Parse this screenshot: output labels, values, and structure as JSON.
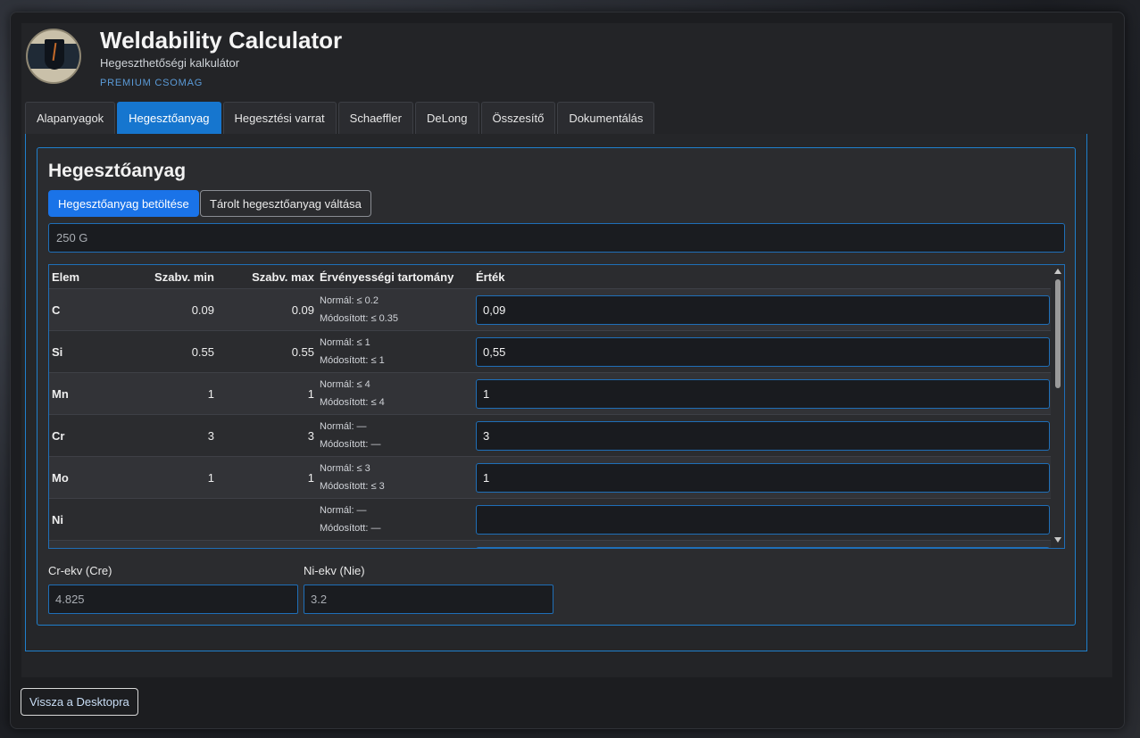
{
  "app": {
    "title": "Weldability Calculator",
    "subtitle": "Hegeszthetőségi kalkulátor",
    "badge": "PREMIUM CSOMAG"
  },
  "tabs": [
    {
      "label": "Alapanyagok",
      "active": false
    },
    {
      "label": "Hegesztőanyag",
      "active": true
    },
    {
      "label": "Hegesztési varrat",
      "active": false
    },
    {
      "label": "Schaeffler",
      "active": false
    },
    {
      "label": "DeLong",
      "active": false
    },
    {
      "label": "Összesítő",
      "active": false
    },
    {
      "label": "Dokumentálás",
      "active": false
    }
  ],
  "panel": {
    "heading": "Hegesztőanyag",
    "load_button": "Hegesztőanyag betöltése",
    "switch_button": "Tárolt hegesztőanyag váltása",
    "material_name": "250 G"
  },
  "table": {
    "headers": {
      "elem": "Elem",
      "min": "Szabv. min",
      "max": "Szabv. max",
      "range": "Érvényességi tartomány",
      "value": "Érték"
    },
    "rows": [
      {
        "elem": "C",
        "min": "0.09",
        "max": "0.09",
        "normal": "Normál: ≤ 0.2",
        "modified": "Módosított: ≤ 0.35",
        "value": "0,09"
      },
      {
        "elem": "Si",
        "min": "0.55",
        "max": "0.55",
        "normal": "Normál: ≤ 1",
        "modified": "Módosított: ≤ 1",
        "value": "0,55"
      },
      {
        "elem": "Mn",
        "min": "1",
        "max": "1",
        "normal": "Normál: ≤ 4",
        "modified": "Módosított: ≤ 4",
        "value": "1"
      },
      {
        "elem": "Cr",
        "min": "3",
        "max": "3",
        "normal": "Normál: —",
        "modified": "Módosított: —",
        "value": "3"
      },
      {
        "elem": "Mo",
        "min": "1",
        "max": "1",
        "normal": "Normál: ≤ 3",
        "modified": "Módosított: ≤ 3",
        "value": "1"
      },
      {
        "elem": "Ni",
        "min": "",
        "max": "",
        "normal": "Normál: —",
        "modified": "Módosított: —",
        "value": ""
      }
    ]
  },
  "equivalents": {
    "cre_label": "Cr-ekv (Cre)",
    "cre_value": "4.825",
    "nie_label": "Ni-ekv (Nie)",
    "nie_value": "3.2"
  },
  "footer": {
    "back_button": "Vissza a Desktopra"
  },
  "colors": {
    "accent": "#1a73e8",
    "border_blue": "#1f7fcc",
    "badge": "#5b9bd8"
  }
}
